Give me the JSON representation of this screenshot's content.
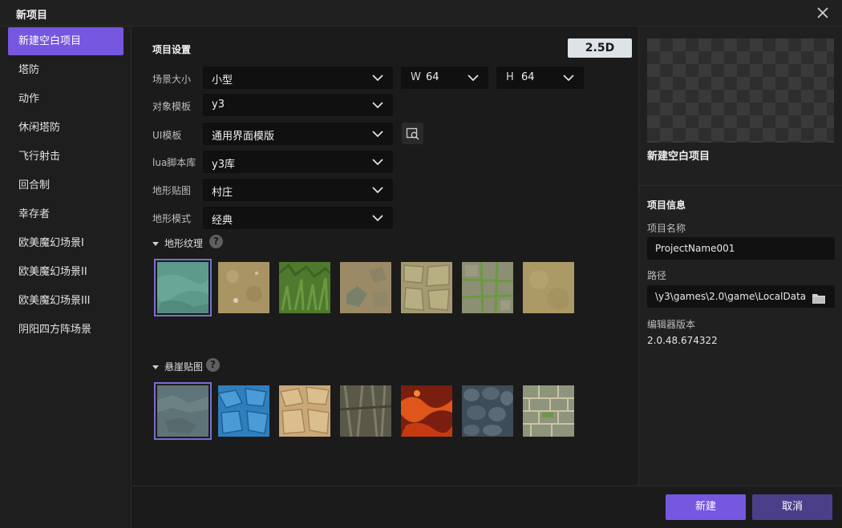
{
  "window": {
    "title": "新项目"
  },
  "sidebar": {
    "items": [
      {
        "label": "新建空白项目",
        "active": true
      },
      {
        "label": "塔防"
      },
      {
        "label": "动作"
      },
      {
        "label": "休闲塔防"
      },
      {
        "label": "飞行射击"
      },
      {
        "label": "回合制"
      },
      {
        "label": "幸存者"
      },
      {
        "label": "欧美魔幻场景I"
      },
      {
        "label": "欧美魔幻场景II"
      },
      {
        "label": "欧美魔幻场景III"
      },
      {
        "label": "阴阳四方阵场景"
      }
    ]
  },
  "settings": {
    "section_title": "项目设置",
    "mode_badge": "2.5D",
    "scene_size": {
      "label": "场景大小",
      "value": "小型",
      "width_prefix": "W",
      "width": "64",
      "height_prefix": "H",
      "height": "64"
    },
    "object_template": {
      "label": "对象模板",
      "value": "y3"
    },
    "ui_template": {
      "label": "UI模板",
      "value": "通用界面模版"
    },
    "lua_library": {
      "label": "lua脚本库",
      "value": "y3库"
    },
    "terrain_map": {
      "label": "地形贴图",
      "value": "村庄"
    },
    "terrain_mode": {
      "label": "地形模式",
      "value": "经典"
    },
    "terrain_texture": {
      "label": "地形纹理",
      "help": "?",
      "selected_index": 0,
      "tiles": [
        "teal-grass",
        "sandy-dirt",
        "green-grass",
        "stone-dirt",
        "stone-slabs",
        "mossy-stone",
        "plain-sand"
      ]
    },
    "cliff_texture": {
      "label": "悬崖贴图",
      "help": "?",
      "selected_index": 0,
      "tiles": [
        "grey-blue-rock",
        "blue-ice",
        "sandstone",
        "dark-rock",
        "lava",
        "cobblestone",
        "stone-brick"
      ]
    }
  },
  "right_panel": {
    "preview_name": "新建空白项目",
    "info_title": "项目信息",
    "project_name_label": "项目名称",
    "project_name": "ProjectName001",
    "path_label": "路径",
    "path": "\\y3\\games\\2.0\\game\\LocalData",
    "editor_version_label": "编辑器版本",
    "editor_version": "2.0.48.674322"
  },
  "footer": {
    "create_label": "新建",
    "cancel_label": "取消"
  },
  "colors": {
    "accent": "#7657e0",
    "secondary_button": "#4b3f8a",
    "badge_bg": "#dde3e6",
    "background": "#1b1b1b"
  }
}
